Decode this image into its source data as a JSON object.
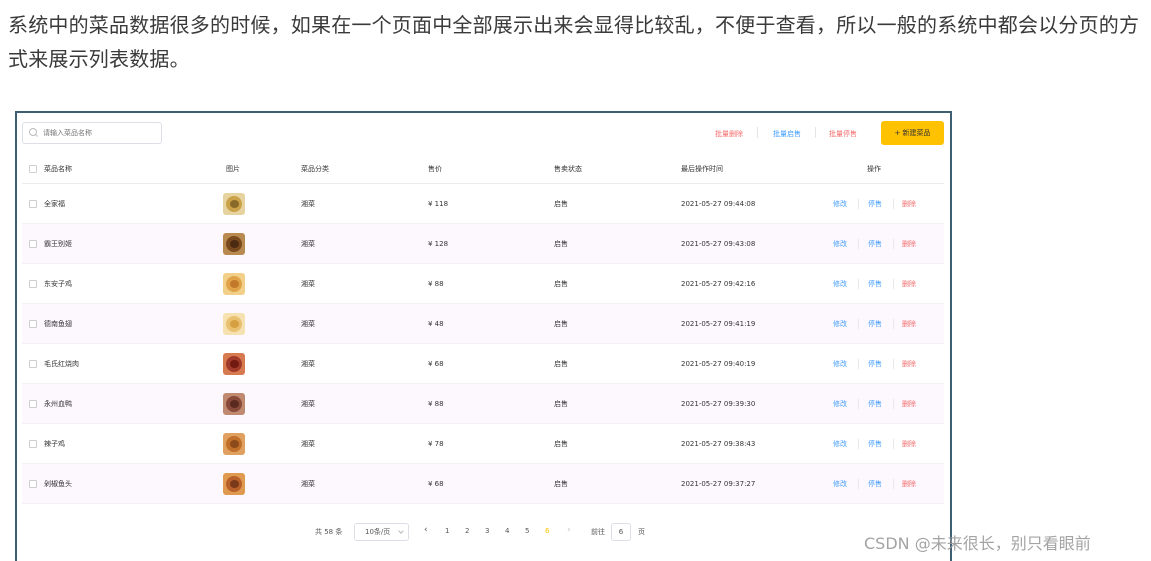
{
  "article": {
    "text": "系统中的菜品数据很多的时候，如果在一个页面中全部展示出来会显得比较乱，不便于查看，所以一般的系统中都会以分页的方式来展示列表数据。"
  },
  "toolbar": {
    "search_placeholder": "请输入菜品名称",
    "batch_delete": "批量删除",
    "batch_start": "批量启售",
    "batch_stop": "批量停售",
    "new_dish": "+ 新建菜品",
    "accent_color": "#ffc200"
  },
  "table": {
    "columns": [
      "菜品名称",
      "图片",
      "菜品分类",
      "售价",
      "售卖状态",
      "最后操作时间",
      "操作"
    ],
    "rows": [
      {
        "name": "全家福",
        "category": "湘菜",
        "price": "¥ 118",
        "status": "启售",
        "time": "2021-05-27 09:44:08"
      },
      {
        "name": "霸王别姬",
        "category": "湘菜",
        "price": "¥ 128",
        "status": "启售",
        "time": "2021-05-27 09:43:08"
      },
      {
        "name": "东安子鸡",
        "category": "湘菜",
        "price": "¥ 88",
        "status": "启售",
        "time": "2021-05-27 09:42:16"
      },
      {
        "name": "德南鱼翅",
        "category": "湘菜",
        "price": "¥ 48",
        "status": "启售",
        "time": "2021-05-27 09:41:19"
      },
      {
        "name": "毛氏红烧肉",
        "category": "湘菜",
        "price": "¥ 68",
        "status": "启售",
        "time": "2021-05-27 09:40:19"
      },
      {
        "name": "永州血鸭",
        "category": "湘菜",
        "price": "¥ 88",
        "status": "启售",
        "time": "2021-05-27 09:39:30"
      },
      {
        "name": "辣子鸡",
        "category": "湘菜",
        "price": "¥ 78",
        "status": "启售",
        "time": "2021-05-27 09:38:43"
      },
      {
        "name": "剁椒鱼头",
        "category": "湘菜",
        "price": "¥ 68",
        "status": "启售",
        "time": "2021-05-27 09:37:27"
      }
    ],
    "actions": {
      "edit": "修改",
      "stop": "停售",
      "delete": "删除"
    }
  },
  "pagination": {
    "total": "共 58 条",
    "page_size": "10条/页",
    "prev": "‹",
    "next": "›",
    "pages": [
      "1",
      "2",
      "3",
      "4",
      "5",
      "6"
    ],
    "current": "6",
    "goto_label": "前往",
    "goto_value": "6",
    "page_suffix": "页"
  },
  "watermark": "CSDN @未来很长，别只看眼前"
}
